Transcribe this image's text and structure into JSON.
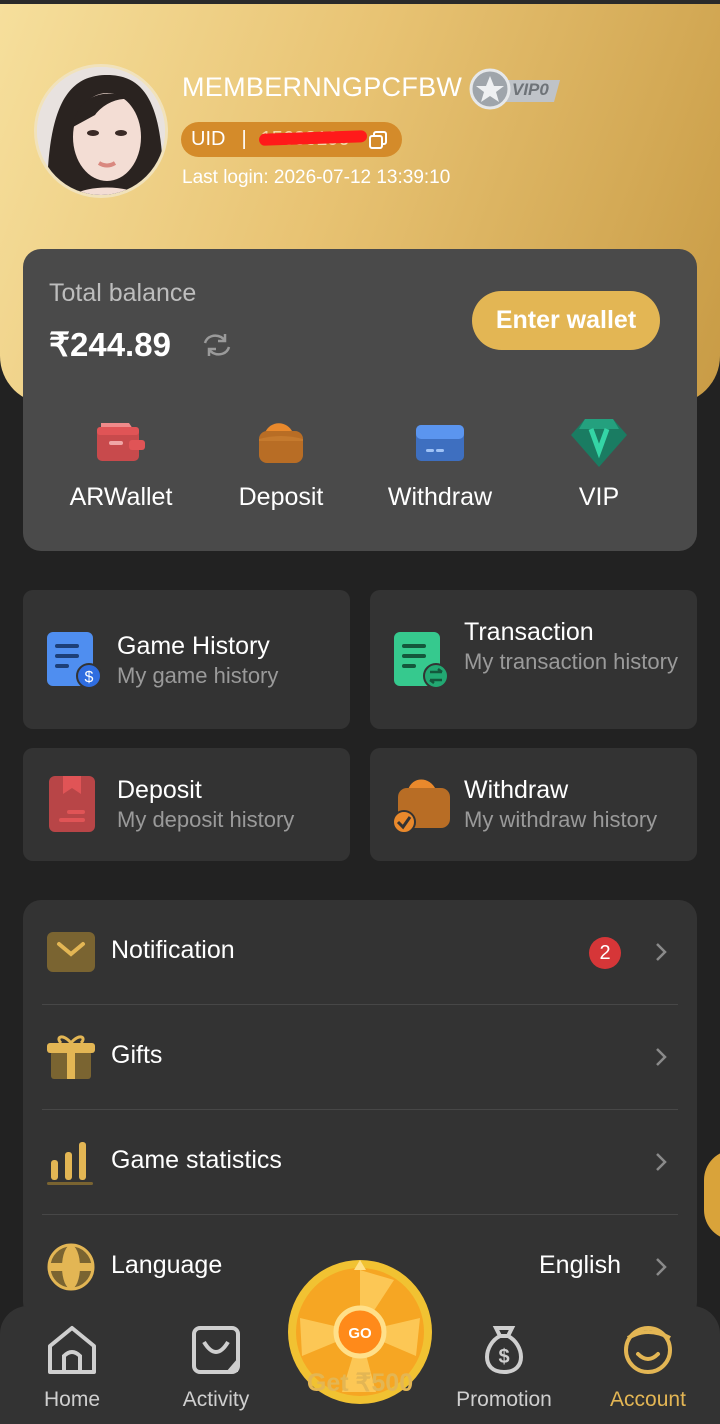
{
  "profile": {
    "username": "MEMBERNNGPCFBW",
    "vip_badge": "VIP0",
    "uid_label": "UID",
    "uid_separator": "|",
    "uid_value": "15638190",
    "last_login": "Last login: 2026-07-12 13:39:10"
  },
  "balance": {
    "label": "Total balance",
    "amount": "₹244.89",
    "enter_wallet": "Enter wallet",
    "quick_actions": [
      {
        "label": "ARWallet",
        "icon": "wallet-icon",
        "color": "#e05456"
      },
      {
        "label": "Deposit",
        "icon": "deposit-purse-icon",
        "color": "#e9892c"
      },
      {
        "label": "Withdraw",
        "icon": "card-icon",
        "color": "#4f8ef0"
      },
      {
        "label": "VIP",
        "icon": "vip-diamond-icon",
        "color": "#1dae85"
      }
    ]
  },
  "history_cards": [
    {
      "title": "Game History",
      "subtitle": "My game history",
      "icon": "game-history-icon",
      "color": "#4f8ef0"
    },
    {
      "title": "Transaction",
      "subtitle": "My transaction history",
      "icon": "transaction-icon",
      "color": "#36c98e"
    },
    {
      "title": "Deposit",
      "subtitle": "My deposit history",
      "icon": "deposit-history-icon",
      "color": "#e05456"
    },
    {
      "title": "Withdraw",
      "subtitle": "My withdraw history",
      "icon": "withdraw-history-icon",
      "color": "#e9892c"
    }
  ],
  "menu": {
    "notification": {
      "label": "Notification",
      "badge": "2"
    },
    "gifts": {
      "label": "Gifts"
    },
    "game_statistics": {
      "label": "Game statistics"
    },
    "language": {
      "label": "Language",
      "value": "English"
    }
  },
  "tabbar": {
    "home": "Home",
    "activity": "Activity",
    "wheel_button": "GO",
    "get_bonus": "Get ₹500",
    "promotion": "Promotion",
    "account": "Account"
  },
  "colors": {
    "accent": "#e3b654",
    "card": "#4a4a4a",
    "background": "#222222"
  }
}
